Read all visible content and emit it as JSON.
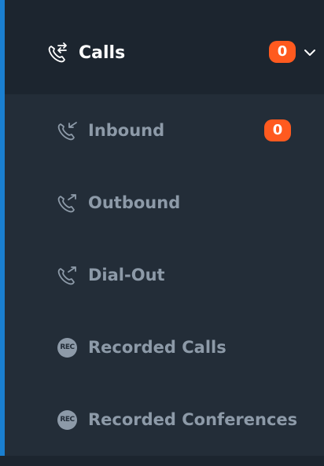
{
  "menu": {
    "title": "Calls",
    "badge": "0",
    "icon": "phone-transfer-icon",
    "expand_icon": "chevron-down-icon"
  },
  "items": [
    {
      "label": "Inbound",
      "icon": "phone-inbound-icon",
      "badge": "0"
    },
    {
      "label": "Outbound",
      "icon": "phone-outbound-icon"
    },
    {
      "label": "Dial-Out",
      "icon": "phone-outbound-icon"
    },
    {
      "label": "Recorded Calls",
      "icon": "rec-icon",
      "icon_text": "REC"
    },
    {
      "label": "Recorded Conferences",
      "icon": "rec-icon",
      "icon_text": "REC"
    }
  ],
  "colors": {
    "accent": "#1a7fd0",
    "badge": "#ff5a1f",
    "header_bg": "#1c252f",
    "submenu_bg": "#232d38",
    "item_text": "#8d9aa8",
    "header_text": "#ffffff"
  }
}
